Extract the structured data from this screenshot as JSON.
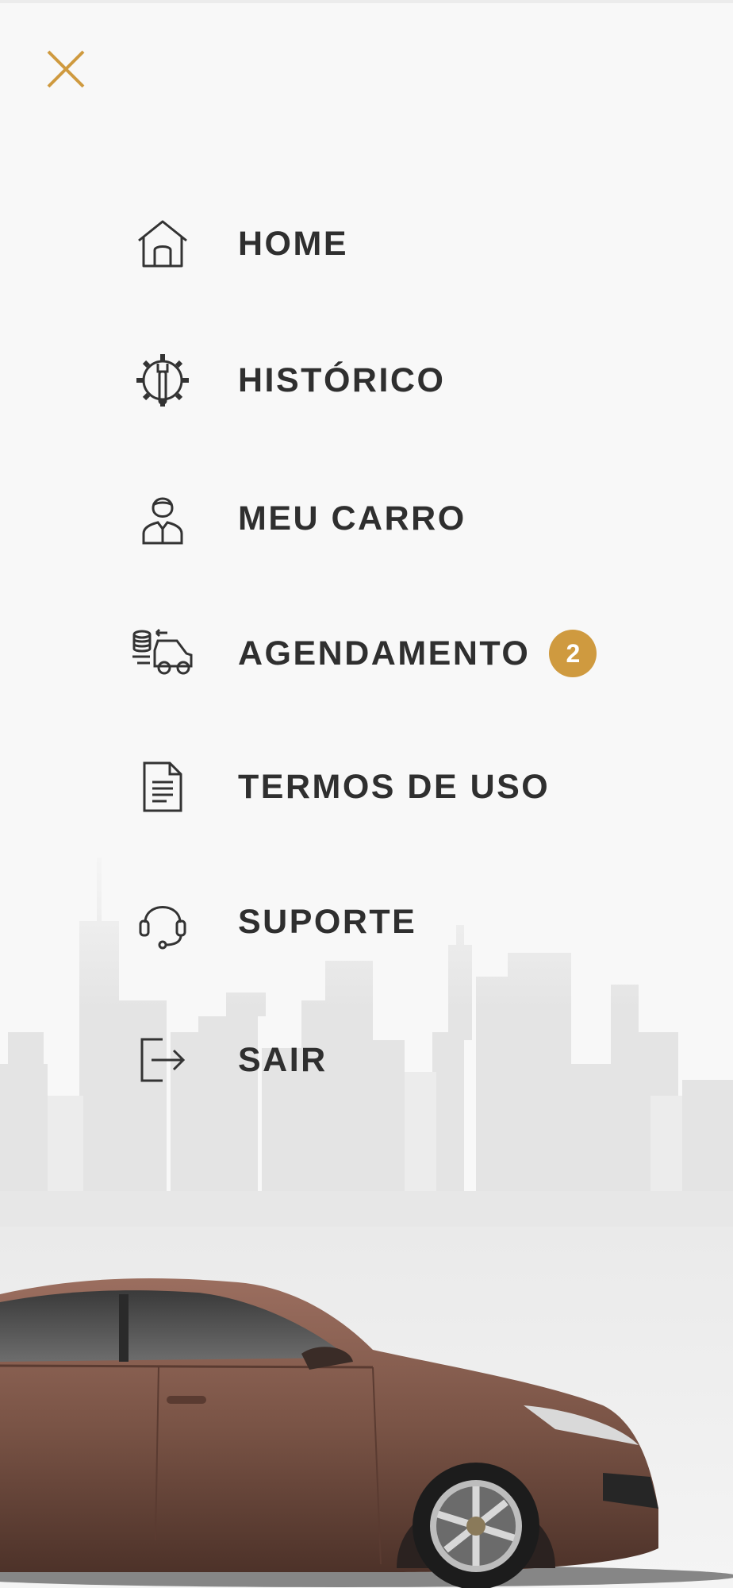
{
  "header": {
    "close_icon": "close-icon",
    "accent_color": "#cf9a3f"
  },
  "menu": {
    "items": [
      {
        "label": "HOME",
        "icon": "home-icon"
      },
      {
        "label": "HISTÓRICO",
        "icon": "wrench-gear-icon"
      },
      {
        "label": "MEU CARRO",
        "icon": "user-icon"
      },
      {
        "label": "AGENDAMENTO",
        "icon": "car-service-icon",
        "badge": "2"
      },
      {
        "label": "TERMOS DE USO",
        "icon": "document-icon"
      },
      {
        "label": "SUPORTE",
        "icon": "headset-icon"
      },
      {
        "label": "SAIR",
        "icon": "logout-icon"
      }
    ]
  },
  "background": {
    "scene": "city-skyline",
    "car_color": "#7a5446"
  }
}
